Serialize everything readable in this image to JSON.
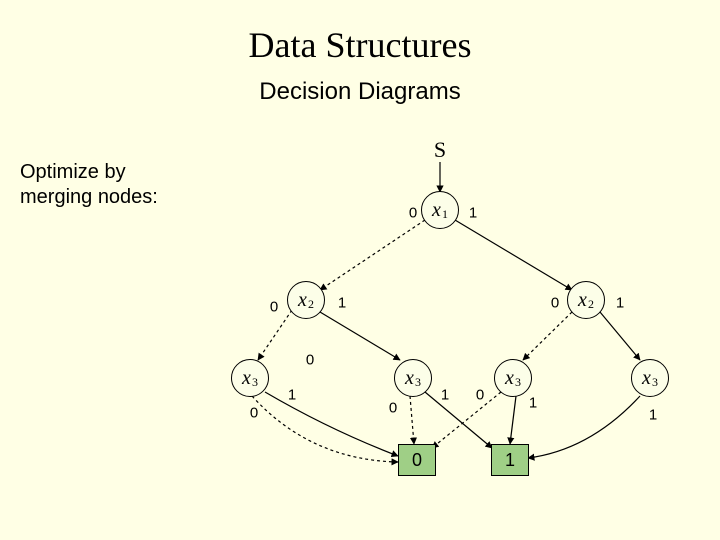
{
  "title": "Data Structures",
  "subtitle": "Decision Diagrams",
  "sidetext_line1": "Optimize by",
  "sidetext_line2": "merging nodes:",
  "root_label": "S",
  "nodes": {
    "x1": {
      "var": "x",
      "sub": "1"
    },
    "x2L": {
      "var": "x",
      "sub": "2"
    },
    "x2R": {
      "var": "x",
      "sub": "2"
    },
    "x3a": {
      "var": "x",
      "sub": "3"
    },
    "x3b": {
      "var": "x",
      "sub": "3"
    },
    "x3c": {
      "var": "x",
      "sub": "3"
    },
    "x3d": {
      "var": "x",
      "sub": "3"
    }
  },
  "terminals": {
    "t0": "0",
    "t1": "1"
  },
  "edge_labels": {
    "x1_0": "0",
    "x1_1": "1",
    "x2L_0": "0",
    "x2L_1": "1",
    "x2R_0": "0",
    "x2R_1": "1",
    "x3a_0": "0",
    "x3a_1": "1",
    "x3b_0": "0",
    "x3b_1": "1",
    "x3c_0": "0",
    "x3c_1": "1",
    "x3d_1": "1"
  }
}
